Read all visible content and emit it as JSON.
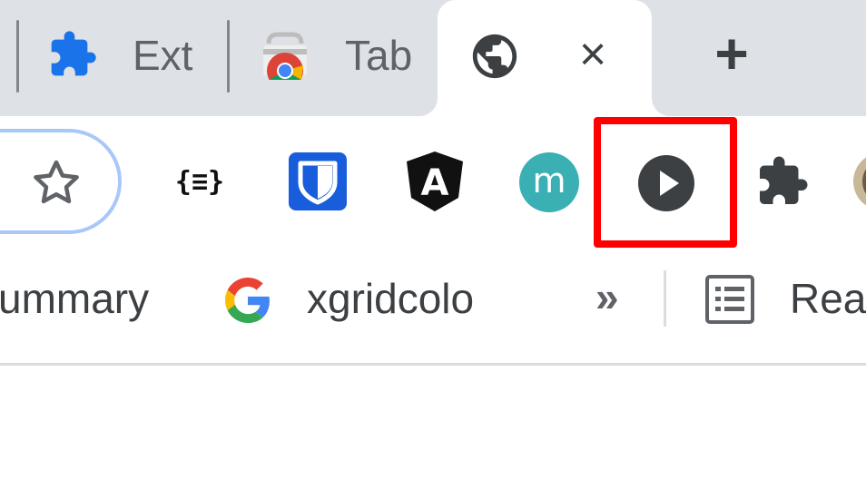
{
  "tabs": [
    {
      "label": "Ext",
      "icon": "puzzle-icon"
    },
    {
      "label": "Tab",
      "icon": "chrome-web-store-icon"
    },
    {
      "label": "",
      "icon": "globe-icon",
      "active": true
    }
  ],
  "tab_close_label": "×",
  "new_tab_label": "+",
  "toolbar": {
    "bookmark_star_icon": "star-icon",
    "extensions": [
      {
        "name": "JSON formatter",
        "glyph": "{≡}"
      },
      {
        "name": "Bitwarden",
        "icon": "bitwarden-shield-icon"
      },
      {
        "name": "Angular DevTools",
        "glyph": "A"
      },
      {
        "name": "m extension",
        "glyph": "m",
        "color": "#3ab0b4"
      },
      {
        "name": "Play extension",
        "icon": "play-circle-icon",
        "highlighted": true
      },
      {
        "name": "Extensions menu",
        "icon": "puzzle-icon"
      }
    ]
  },
  "bookmarks": {
    "items": [
      {
        "label": "ummary"
      },
      {
        "label": "xgridcolo",
        "icon": "google-g-icon"
      }
    ],
    "overflow_label": "»",
    "reading_list_label": "Rea"
  },
  "colors": {
    "tab_strip_bg": "#dee1e6",
    "highlight": "#ff0000",
    "omnibox_border": "#a8c7fa",
    "bitwarden_blue": "#175ddc",
    "m_teal": "#3ab0b4",
    "icon_dark": "#3c4043"
  }
}
